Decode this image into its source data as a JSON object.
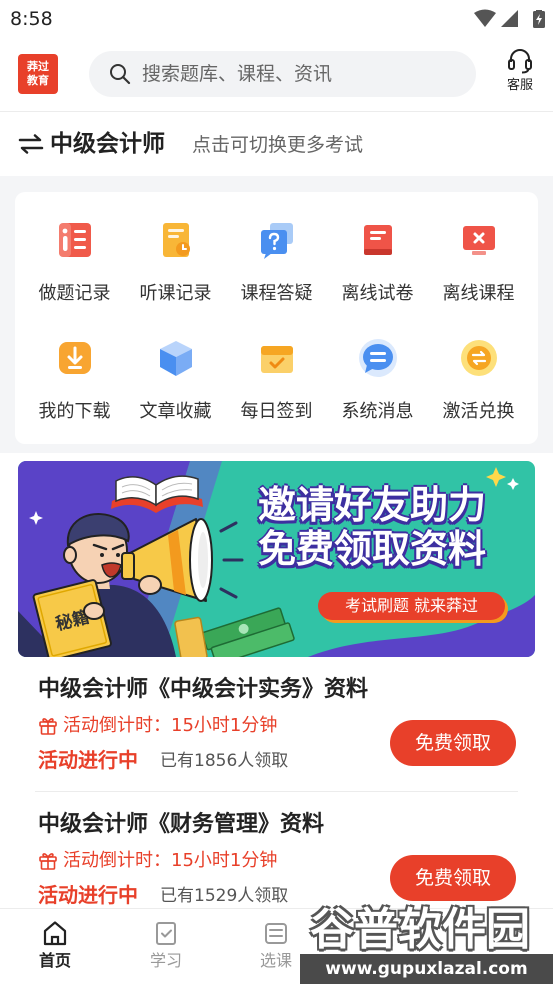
{
  "status_bar": {
    "time": "8:58"
  },
  "header": {
    "logo": {
      "line1": "莽过",
      "line2": "教育"
    },
    "search_placeholder": "搜索题库、课程、资讯",
    "service_label": "客服"
  },
  "exam_switcher": {
    "exam_name": "中级会计师",
    "hint": "点击可切换更多考试"
  },
  "quick_menu": [
    {
      "label": "做题记录",
      "icon": "practice-record-icon"
    },
    {
      "label": "听课记录",
      "icon": "lecture-record-icon"
    },
    {
      "label": "课程答疑",
      "icon": "course-qa-icon"
    },
    {
      "label": "离线试卷",
      "icon": "offline-exam-icon"
    },
    {
      "label": "离线课程",
      "icon": "offline-course-icon"
    },
    {
      "label": "我的下载",
      "icon": "download-icon"
    },
    {
      "label": "文章收藏",
      "icon": "favorite-articles-icon"
    },
    {
      "label": "每日签到",
      "icon": "daily-checkin-icon"
    },
    {
      "label": "系统消息",
      "icon": "system-message-icon"
    },
    {
      "label": "激活兑换",
      "icon": "activate-redeem-icon"
    }
  ],
  "banner": {
    "line1": "邀请好友助力",
    "line2": "免费领取资料",
    "slogan": "考试刷题 就来莽过",
    "book_label": "秘籍"
  },
  "materials": [
    {
      "title": "中级会计师《中级会计实务》资料",
      "countdown": "活动倒计时：15小时1分钟",
      "status": "活动进行中",
      "claimed": "已有1856人领取",
      "button": "免费领取"
    },
    {
      "title": "中级会计师《财务管理》资料",
      "countdown": "活动倒计时：15小时1分钟",
      "status": "活动进行中",
      "claimed": "已有1529人领取",
      "button": "免费领取"
    }
  ],
  "bottom_nav": [
    {
      "label": "首页",
      "icon": "home-icon",
      "active": true
    },
    {
      "label": "学习",
      "icon": "study-icon",
      "active": false
    },
    {
      "label": "选课",
      "icon": "course-select-icon",
      "active": false
    }
  ],
  "watermark": {
    "name": "谷普软件园",
    "url": "www.gupuxlazal.com"
  },
  "colors": {
    "brand_red": "#e8402a",
    "banner_teal": "#31c3a6",
    "banner_purple": "#5a43c7",
    "page_background": "#f4f5f7"
  }
}
